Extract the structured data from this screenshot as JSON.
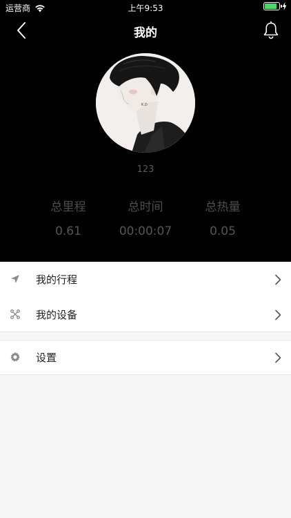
{
  "status_bar": {
    "carrier": "运营商",
    "time": "上午9:53",
    "battery_level": 0.9
  },
  "nav": {
    "title": "我的",
    "back_icon": "chevron-left-icon",
    "bell_icon": "bell-icon"
  },
  "profile": {
    "username": "123"
  },
  "stats": [
    {
      "label": "总里程",
      "value": "0.61"
    },
    {
      "label": "总时间",
      "value": "00:00:07"
    },
    {
      "label": "总热量",
      "value": "0.05"
    }
  ],
  "menu": {
    "group1": [
      {
        "label": "我的行程",
        "icon": "navigation-arrow-icon"
      },
      {
        "label": "我的设备",
        "icon": "drone-icon"
      }
    ],
    "group2": [
      {
        "label": "设置",
        "icon": "gear-icon"
      }
    ]
  },
  "colors": {
    "header_bg": "#000000",
    "page_bg": "#f7f7f7",
    "battery": "#4cd964"
  }
}
